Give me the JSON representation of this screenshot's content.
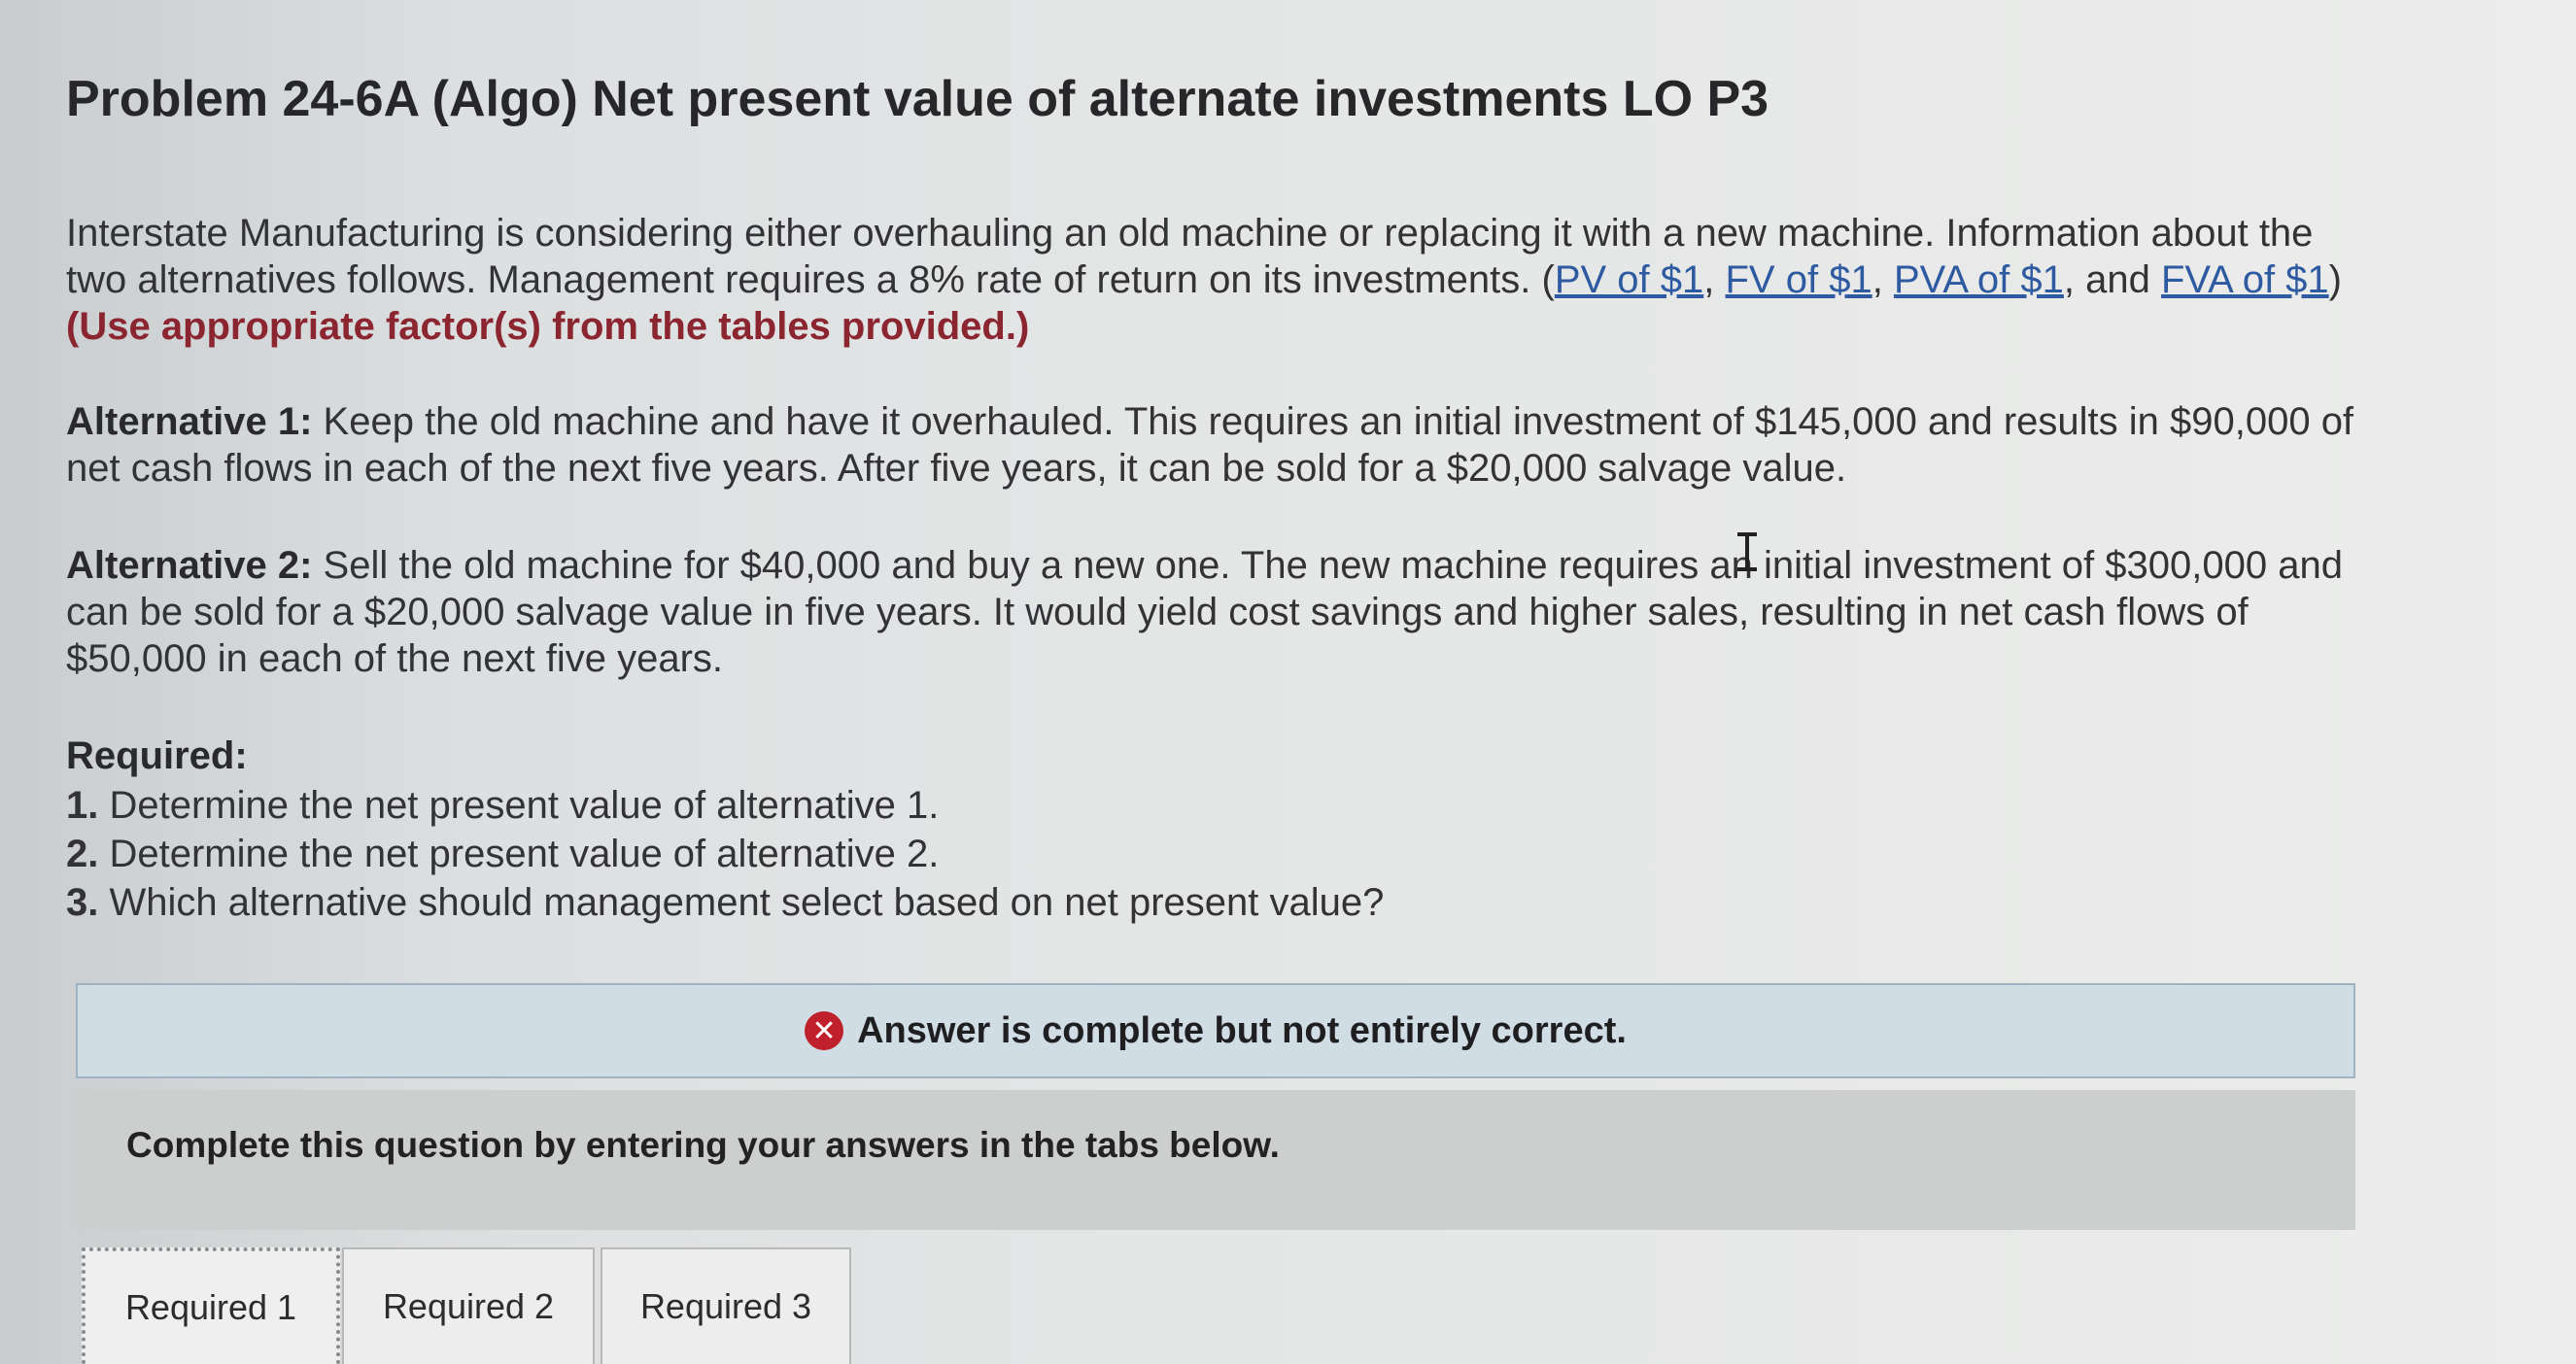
{
  "title": "Problem 24-6A (Algo) Net present value of alternate investments LO P3",
  "intro": {
    "line1": "Interstate Manufacturing is considering either overhauling an old machine or replacing it with a new machine. Information about the",
    "line2_pre": "two alternatives follows. Management requires a 8% rate of return on its investments. (",
    "link_pv": "PV of $1",
    "sep1": ", ",
    "link_fv": "FV of $1",
    "sep2": ", ",
    "link_pva": "PVA of $1",
    "sep3": ", and ",
    "link_fva": "FVA of $1",
    "line2_post": ")",
    "line3": "(Use appropriate factor(s) from the tables provided.)"
  },
  "alt1": {
    "label": "Alternative 1:",
    "line1": " Keep the old machine and have it overhauled. This requires an initial investment of $145,000 and results in $90,000 of",
    "line2": "net cash flows in each of the next five years. After five years, it can be sold for a $20,000 salvage value."
  },
  "alt2": {
    "label": "Alternative 2:",
    "line1": " Sell the old machine for $40,000 and buy a new one. The new machine requires an initial investment of $300,000 and",
    "line2": "can be sold for a $20,000 salvage value in five years. It would yield cost savings and higher sales, resulting in net cash flows of",
    "line3": "$50,000 in each of the next five years."
  },
  "required": {
    "heading": "Required:",
    "items": [
      {
        "num": "1.",
        "text": " Determine the net present value of alternative 1."
      },
      {
        "num": "2.",
        "text": " Determine the net present value of alternative 2."
      },
      {
        "num": "3.",
        "text": " Which alternative should management select based on net present value?"
      }
    ]
  },
  "banner": {
    "icon": "x-circle-icon",
    "icon_glyph": "✕",
    "text": "Answer is complete but not entirely correct.",
    "icon_color": "#c0202b"
  },
  "instruction": "Complete this question by entering your answers in the tabs below.",
  "tabs": [
    {
      "label": "Required 1",
      "active": true
    },
    {
      "label": "Required 2",
      "active": false
    },
    {
      "label": "Required 3",
      "active": false
    }
  ]
}
